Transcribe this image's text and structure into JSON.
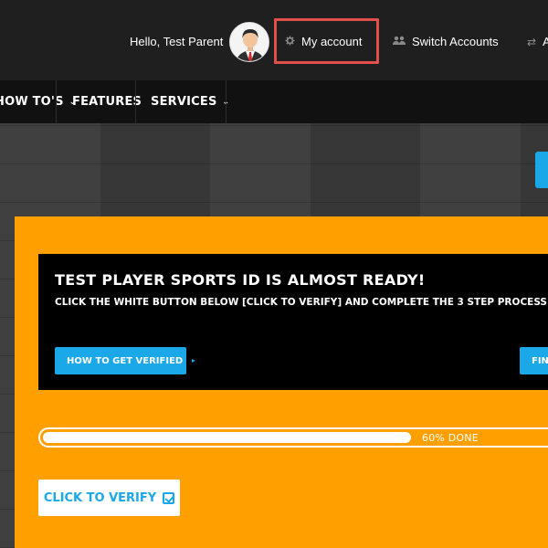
{
  "header": {
    "greeting": "Hello, Test Parent",
    "my_account_label": "My account",
    "switch_accounts_label": "Switch Accounts",
    "last_link_label": "A",
    "icons": {
      "my_account": "gear-icon",
      "switch_accounts": "users-icon",
      "last_link": "swap-arrows-icon"
    }
  },
  "nav": {
    "items": [
      {
        "label": "HOW TO'S",
        "has_dropdown": true
      },
      {
        "label": "FEATURES",
        "has_dropdown": false
      },
      {
        "label": "SERVICES",
        "has_dropdown": true
      }
    ]
  },
  "notice": {
    "title": "TEST PLAYER SPORTS ID IS ALMOST READY!",
    "subtitle": "CLICK THE WHITE BUTTON BELOW [CLICK TO VERIFY] AND COMPLETE THE 3 STEP PROCESS.",
    "how_button": "HOW TO GET VERIFIED",
    "find_button": "FIN"
  },
  "progress": {
    "percent": 60,
    "label": "60% DONE"
  },
  "verify_button": "CLICK TO VERIFY",
  "colors": {
    "accent_blue": "#1aa8e8",
    "panel_orange": "#ffa000",
    "highlight_red": "#e2504b",
    "topbar_bg": "#1f1f1f",
    "navbar_bg": "#111111"
  }
}
